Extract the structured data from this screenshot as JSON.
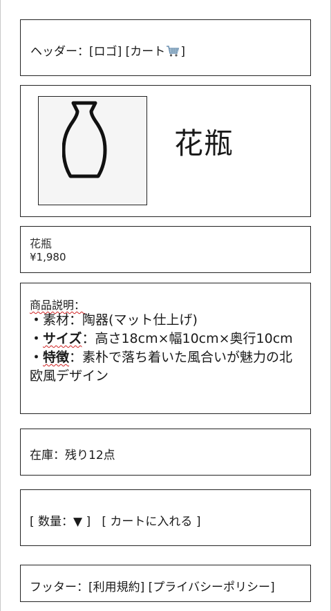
{
  "header": {
    "prefix": "ヘッダー：",
    "logo": "[ロゴ]",
    "cart_open": " [カート",
    "cart_close": "]"
  },
  "hero": {
    "image_icon": "vase-icon",
    "title": "花瓶"
  },
  "summary": {
    "name": "花瓶",
    "price": "¥1,980"
  },
  "description": {
    "label": "商品説明：",
    "bullet": "・",
    "material_label": "素材",
    "material_value": "：陶器(マット仕上げ)",
    "size_label": "サイズ",
    "size_value": "：高さ18cm×幅10cm×奥行10cm",
    "feature_label": "特徴",
    "feature_value": "：素朴で落ち着いた風合いが魅力の北欧風デザイン"
  },
  "stock": {
    "text": "在庫：残り12点"
  },
  "purchase": {
    "quantity": "[ 数量：▼ ]",
    "add_to_cart": "[ カートに入れる ]"
  },
  "footer": {
    "prefix": "フッター：",
    "terms": "[利用規約]",
    "privacy": "[プライバシーポリシー]"
  },
  "colors": {
    "border": "#222222",
    "image_bg": "#f5f5f5",
    "squiggle": "#d02020",
    "cart_icon": "#6a8fb0"
  }
}
